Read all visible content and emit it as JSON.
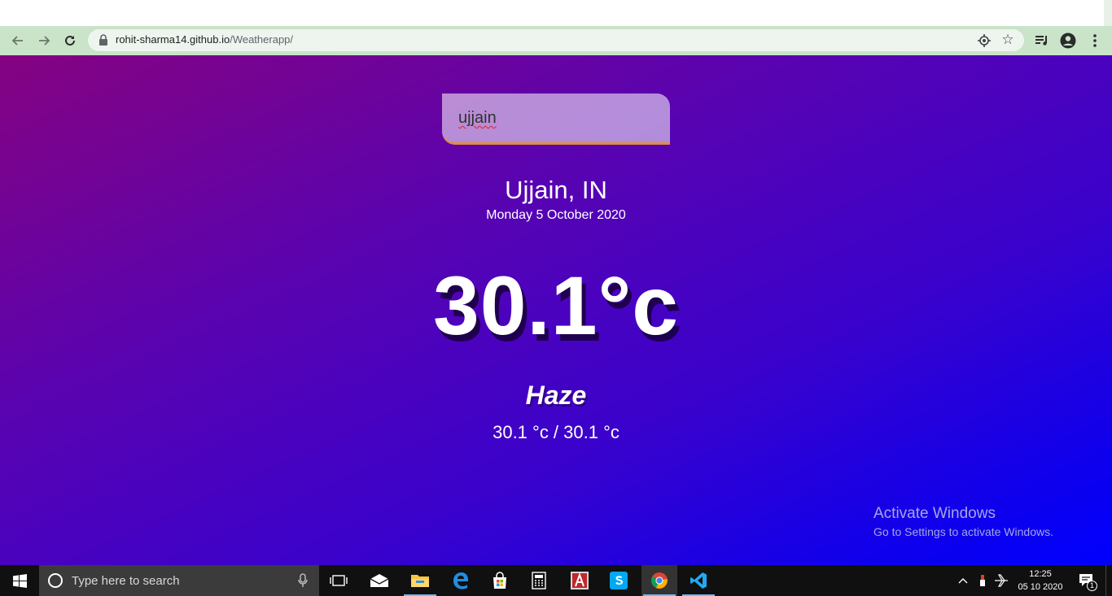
{
  "browser": {
    "url_host": "rohit-sharma14.github.io",
    "url_path": "/Weatherapp/"
  },
  "app": {
    "search_value": "ujjain",
    "location": "Ujjain, IN",
    "date": "Monday 5 October 2020",
    "temperature": "30.1°c",
    "condition": "Haze",
    "hi_low": "30.1 °c / 30.1 °c"
  },
  "watermark": {
    "line1": "Activate Windows",
    "line2": "Go to Settings to activate Windows."
  },
  "taskbar": {
    "search_placeholder": "Type here to search",
    "time": "12:25",
    "date": "05 10 2020",
    "notification_count": "1"
  },
  "colors": {
    "gradient_start": "#850381",
    "gradient_end": "#0000ff",
    "accent_underline": "#df8e3e"
  }
}
